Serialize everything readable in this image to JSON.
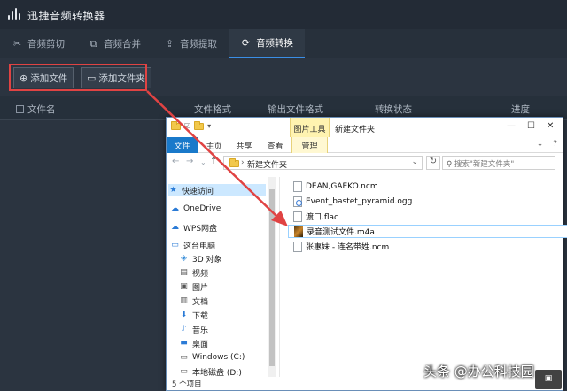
{
  "app": {
    "title": "迅捷音频转换器",
    "accent": "#3a8ee6",
    "tabs": [
      {
        "label": "音频剪切",
        "icon": "scissors-icon",
        "active": false
      },
      {
        "label": "音频合并",
        "icon": "merge-icon",
        "active": false
      },
      {
        "label": "音频提取",
        "icon": "extract-icon",
        "active": false
      },
      {
        "label": "音频转换",
        "icon": "convert-icon",
        "active": true
      }
    ],
    "toolbar": {
      "add_file": "添加文件",
      "add_folder": "添加文件夹"
    },
    "columns": {
      "name": "文件名",
      "format": "文件格式",
      "output_format": "输出文件格式",
      "status": "转换状态",
      "progress": "进度"
    },
    "highlight_color": "#e04343"
  },
  "explorer": {
    "context_tab": "图片工具",
    "window_title": "新建文件夹",
    "ribbon": {
      "file": "文件",
      "home": "主页",
      "share": "共享",
      "view": "查看",
      "manage": "管理"
    },
    "address": "新建文件夹",
    "search_placeholder": "搜索\"新建文件夹\"",
    "nav": [
      {
        "label": "快速访问",
        "icon": "star-icon"
      },
      {
        "label": "OneDrive",
        "icon": "cloud-icon"
      },
      {
        "label": "WPS网盘",
        "icon": "cloud-icon"
      },
      {
        "label": "这台电脑",
        "icon": "computer-icon"
      },
      {
        "label": "3D 对象",
        "icon": "cube-icon"
      },
      {
        "label": "视频",
        "icon": "video-icon"
      },
      {
        "label": "图片",
        "icon": "picture-icon"
      },
      {
        "label": "文档",
        "icon": "document-icon"
      },
      {
        "label": "下载",
        "icon": "download-icon"
      },
      {
        "label": "音乐",
        "icon": "music-icon"
      },
      {
        "label": "桌面",
        "icon": "desktop-icon"
      },
      {
        "label": "Windows (C:)",
        "icon": "drive-icon"
      },
      {
        "label": "本地磁盘 (D:)",
        "icon": "drive-icon"
      }
    ],
    "files": [
      {
        "name": "DEAN,GAEKO.ncm",
        "icon": "document-icon",
        "selected": false
      },
      {
        "name": "Event_bastet_pyramid.ogg",
        "icon": "audio-file-icon",
        "selected": false
      },
      {
        "name": "渡口.flac",
        "icon": "document-icon",
        "selected": false
      },
      {
        "name": "录音测试文件.m4a",
        "icon": "m4a-file-icon",
        "selected": true
      },
      {
        "name": "张惠妹 - 连名带姓.ncm",
        "icon": "document-icon",
        "selected": false
      }
    ],
    "status": "5 个项目"
  },
  "watermark": {
    "text": "头条 @办公科技园"
  }
}
